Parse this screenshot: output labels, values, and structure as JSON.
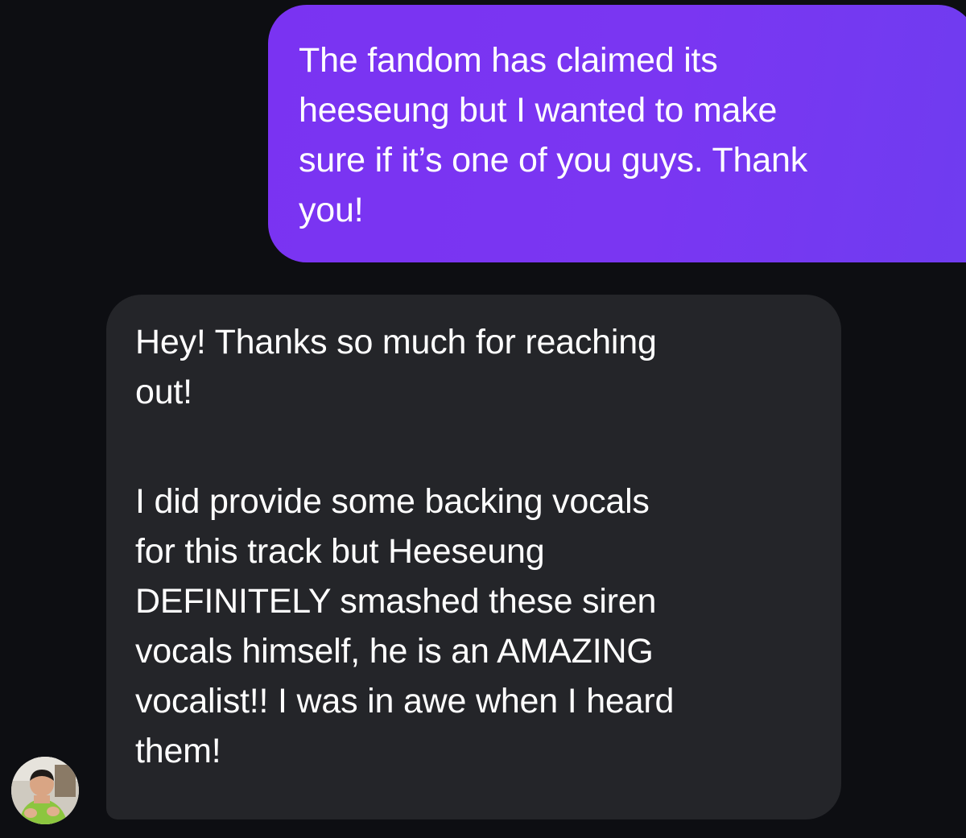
{
  "conversation": {
    "sent_message": {
      "text": "The fandom has claimed its\nheeseung but I wanted to make\nsure if it’s one of you guys. Thank\nyou!"
    },
    "received_message": {
      "paragraph_1": "Hey! Thanks so much for reaching\nout!",
      "paragraph_2": "I did provide some backing vocals\nfor this track but Heeseung\nDEFINITELY smashed these siren\nvocals himself, he is an AMAZING\nvocalist!! I was in awe when I heard\nthem!"
    },
    "sender_avatar": {
      "icon": "profile-avatar"
    }
  },
  "colors": {
    "background": "#0d0e12",
    "sent_bubble": "#7a36f2",
    "received_bubble": "#242529",
    "text": "#ffffff"
  }
}
